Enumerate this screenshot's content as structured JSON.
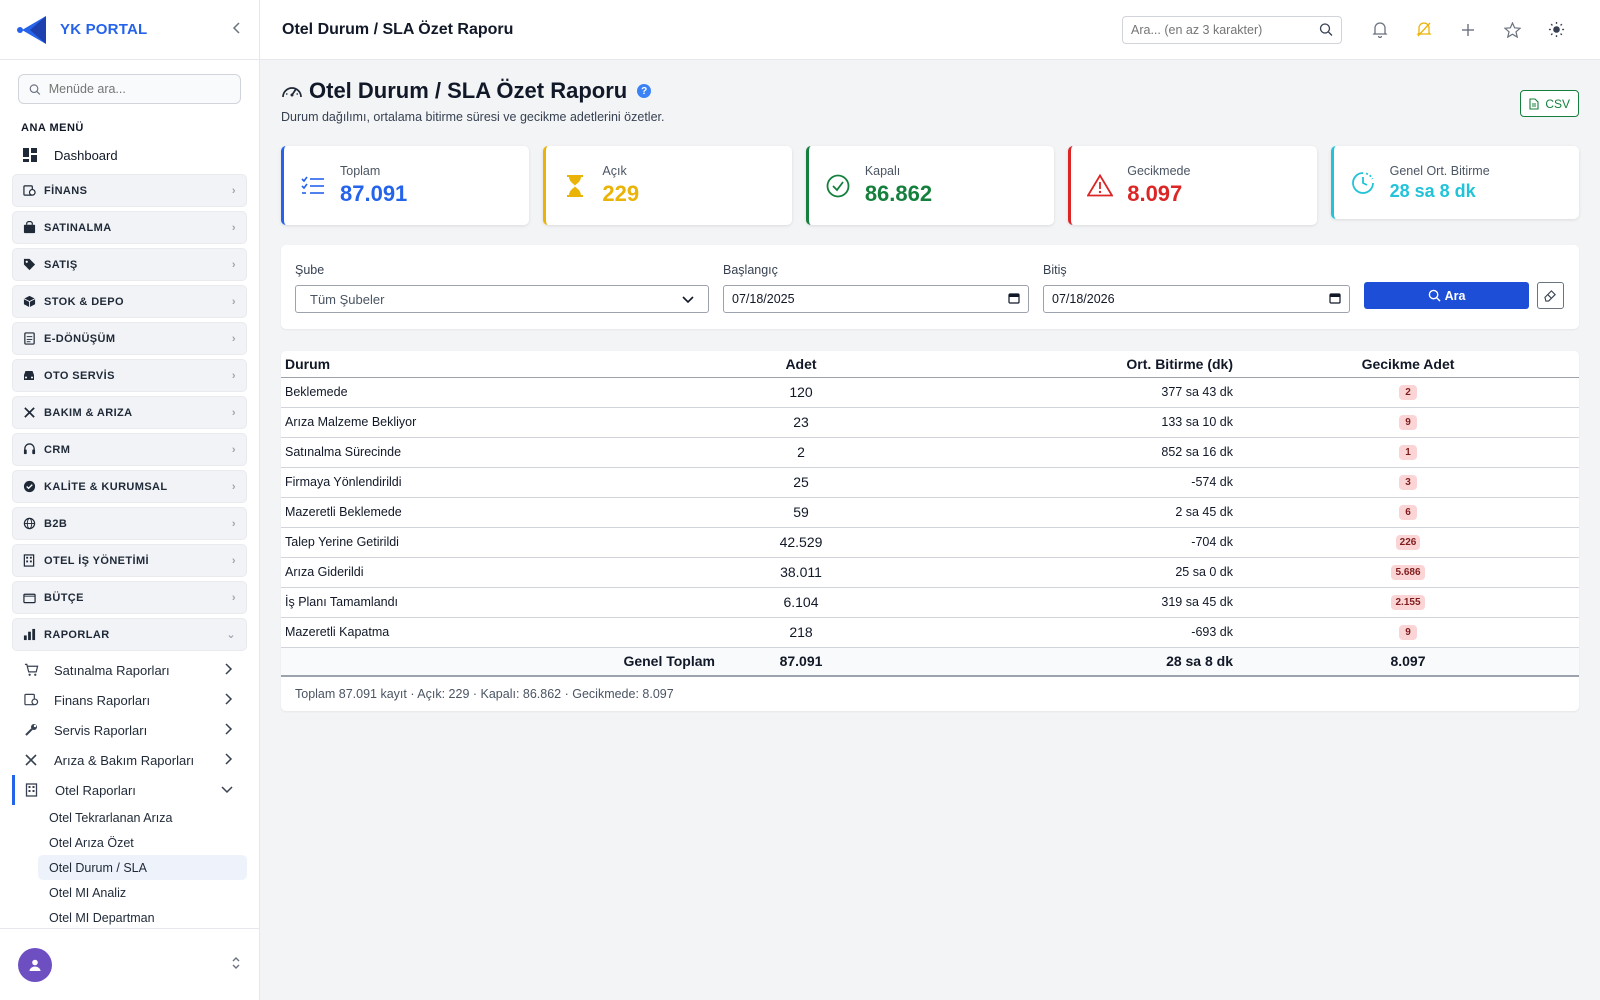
{
  "brand": {
    "name": "YK PORTAL"
  },
  "sidebar": {
    "search_placeholder": "Menüde ara...",
    "section_title": "ANA MENÜ",
    "dashboard": "Dashboard",
    "groups": [
      {
        "label": "FİNANS",
        "icon": "finance-icon"
      },
      {
        "label": "SATINALMA",
        "icon": "bag-icon"
      },
      {
        "label": "SATIŞ",
        "icon": "tag-icon"
      },
      {
        "label": "STOK & DEPO",
        "icon": "box-icon"
      },
      {
        "label": "E-DÖNÜŞÜM",
        "icon": "document-icon"
      },
      {
        "label": "OTO SERVİS",
        "icon": "car-icon"
      },
      {
        "label": "BAKIM & ARIZA",
        "icon": "tools-icon"
      },
      {
        "label": "CRM",
        "icon": "headset-icon"
      },
      {
        "label": "KALİTE & KURUMSAL",
        "icon": "badge-check-icon"
      },
      {
        "label": "B2B",
        "icon": "globe-icon"
      },
      {
        "label": "OTEL İŞ YÖNETİMİ",
        "icon": "building-icon"
      },
      {
        "label": "BÜTÇE",
        "icon": "wallet-icon"
      },
      {
        "label": "RAPORLAR",
        "icon": "bar-chart-icon"
      }
    ],
    "report_subs": [
      {
        "label": "Satınalma Raporları"
      },
      {
        "label": "Finans Raporları"
      },
      {
        "label": "Servis Raporları"
      },
      {
        "label": "Arıza & Bakım Raporları"
      },
      {
        "label": "Otel Raporları"
      }
    ],
    "hotel_reports": [
      {
        "label": "Otel Tekrarlanan Arıza"
      },
      {
        "label": "Otel Arıza Özet"
      },
      {
        "label": "Otel Durum / SLA"
      },
      {
        "label": "Otel MI Analiz"
      },
      {
        "label": "Otel MI Departman"
      }
    ]
  },
  "topbar": {
    "title": "Otel Durum / SLA Özet Raporu",
    "search_placeholder": "Ara... (en az 3 karakter)"
  },
  "page": {
    "title": "Otel Durum / SLA Özet Raporu",
    "subtitle": "Durum dağılımı, ortalama bitirme süresi ve gecikme adetlerini özetler.",
    "help": "?",
    "csv_label": "CSV"
  },
  "cards": [
    {
      "label": "Toplam",
      "value": "87.091",
      "color": "#2563eb"
    },
    {
      "label": "Açık",
      "value": "229",
      "color": "#eab308"
    },
    {
      "label": "Kapalı",
      "value": "86.862",
      "color": "#15803d"
    },
    {
      "label": "Gecikmede",
      "value": "8.097",
      "color": "#dc2626"
    },
    {
      "label": "Genel Ort. Bitirme",
      "value": "28 sa 8 dk",
      "color": "#22c3d9"
    }
  ],
  "filters": {
    "branch_label": "Şube",
    "branch_value": "Tüm Şubeler",
    "start_label": "Başlangıç",
    "start_value": "07/18/2025",
    "end_label": "Bitiş",
    "end_value": "07/18/2026",
    "search_button": "Ara"
  },
  "table": {
    "headers": {
      "status": "Durum",
      "count": "Adet",
      "avg": "Ort. Bitirme (dk)",
      "late": "Gecikme Adet"
    },
    "rows": [
      {
        "status": "Beklemede",
        "count": "120",
        "avg": "377 sa 43 dk",
        "late": "2"
      },
      {
        "status": "Arıza Malzeme Bekliyor",
        "count": "23",
        "avg": "133 sa 10 dk",
        "late": "9"
      },
      {
        "status": "Satınalma Sürecinde",
        "count": "2",
        "avg": "852 sa 16 dk",
        "late": "1"
      },
      {
        "status": "Firmaya Yönlendirildi",
        "count": "25",
        "avg": "-574 dk",
        "late": "3"
      },
      {
        "status": "Mazeretli Beklemede",
        "count": "59",
        "avg": "2 sa 45 dk",
        "late": "6"
      },
      {
        "status": "Talep Yerine Getirildi",
        "count": "42.529",
        "avg": "-704 dk",
        "late": "226"
      },
      {
        "status": "Arıza Giderildi",
        "count": "38.011",
        "avg": "25 sa 0 dk",
        "late": "5.686"
      },
      {
        "status": "İş Planı Tamamlandı",
        "count": "6.104",
        "avg": "319 sa 45 dk",
        "late": "2.155"
      },
      {
        "status": "Mazeretli Kapatma",
        "count": "218",
        "avg": "-693 dk",
        "late": "9"
      }
    ],
    "total": {
      "label": "Genel Toplam",
      "count": "87.091",
      "avg": "28 sa 8 dk",
      "late": "8.097"
    },
    "footer": "Toplam 87.091 kayıt · Açık: 229 · Kapalı: 86.862 · Gecikmede: 8.097"
  }
}
